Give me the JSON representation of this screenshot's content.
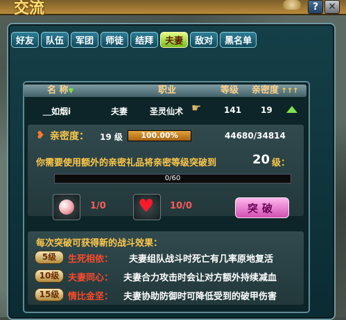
{
  "window": {
    "title": "交流"
  },
  "tabs": [
    {
      "label": "好友"
    },
    {
      "label": "队伍"
    },
    {
      "label": "军团"
    },
    {
      "label": "师徒"
    },
    {
      "label": "结拜"
    },
    {
      "label": "夫妻"
    },
    {
      "label": "敌对"
    },
    {
      "label": "黑名单"
    }
  ],
  "active_tab": "夫妻",
  "table": {
    "headers": {
      "name": "名 称",
      "job": "职业",
      "level": "等级",
      "intimacy": "亲密度"
    },
    "row": {
      "name": "＿如烟i",
      "relation": "夫妻",
      "job": "圣灵仙术",
      "level": "141",
      "intimacy": "19"
    }
  },
  "intimacy": {
    "label": "亲密度：",
    "level": "19 级",
    "bar_text": "100.00%",
    "progress": 1.0,
    "exp": "44680/34814"
  },
  "breakthrough": {
    "prompt": "你需要使用额外的亲密礼品将亲密等级突破到",
    "target": "20",
    "target_unit": "级：",
    "bar_text": "0/60",
    "progress": 0.0,
    "item1_count": "1/0",
    "item2_count": "10/0",
    "button": "突破"
  },
  "effects": {
    "title": "每次突破可获得新的战斗效果：",
    "items": [
      {
        "level": "5级",
        "name": "生死相依：",
        "desc": "夫妻组队战斗时死亡有几率原地复活"
      },
      {
        "level": "10级",
        "name": "夫妻同心：",
        "desc": "夫妻合力攻击时会让对方额外持续减血"
      },
      {
        "level": "15级",
        "name": "情比金坚：",
        "desc": "夫妻协助防御时可降低受到的破甲伤害"
      }
    ]
  },
  "colors": {
    "accent": "#ffc84a",
    "active_tab": "#79b81c",
    "intimacy_bar": "#c8871a",
    "effect_name": "#ff4a2a"
  },
  "icons": {
    "heart": "heart-icon",
    "pearl": "pearl-icon",
    "help": "help-icon",
    "close": "close-icon"
  }
}
